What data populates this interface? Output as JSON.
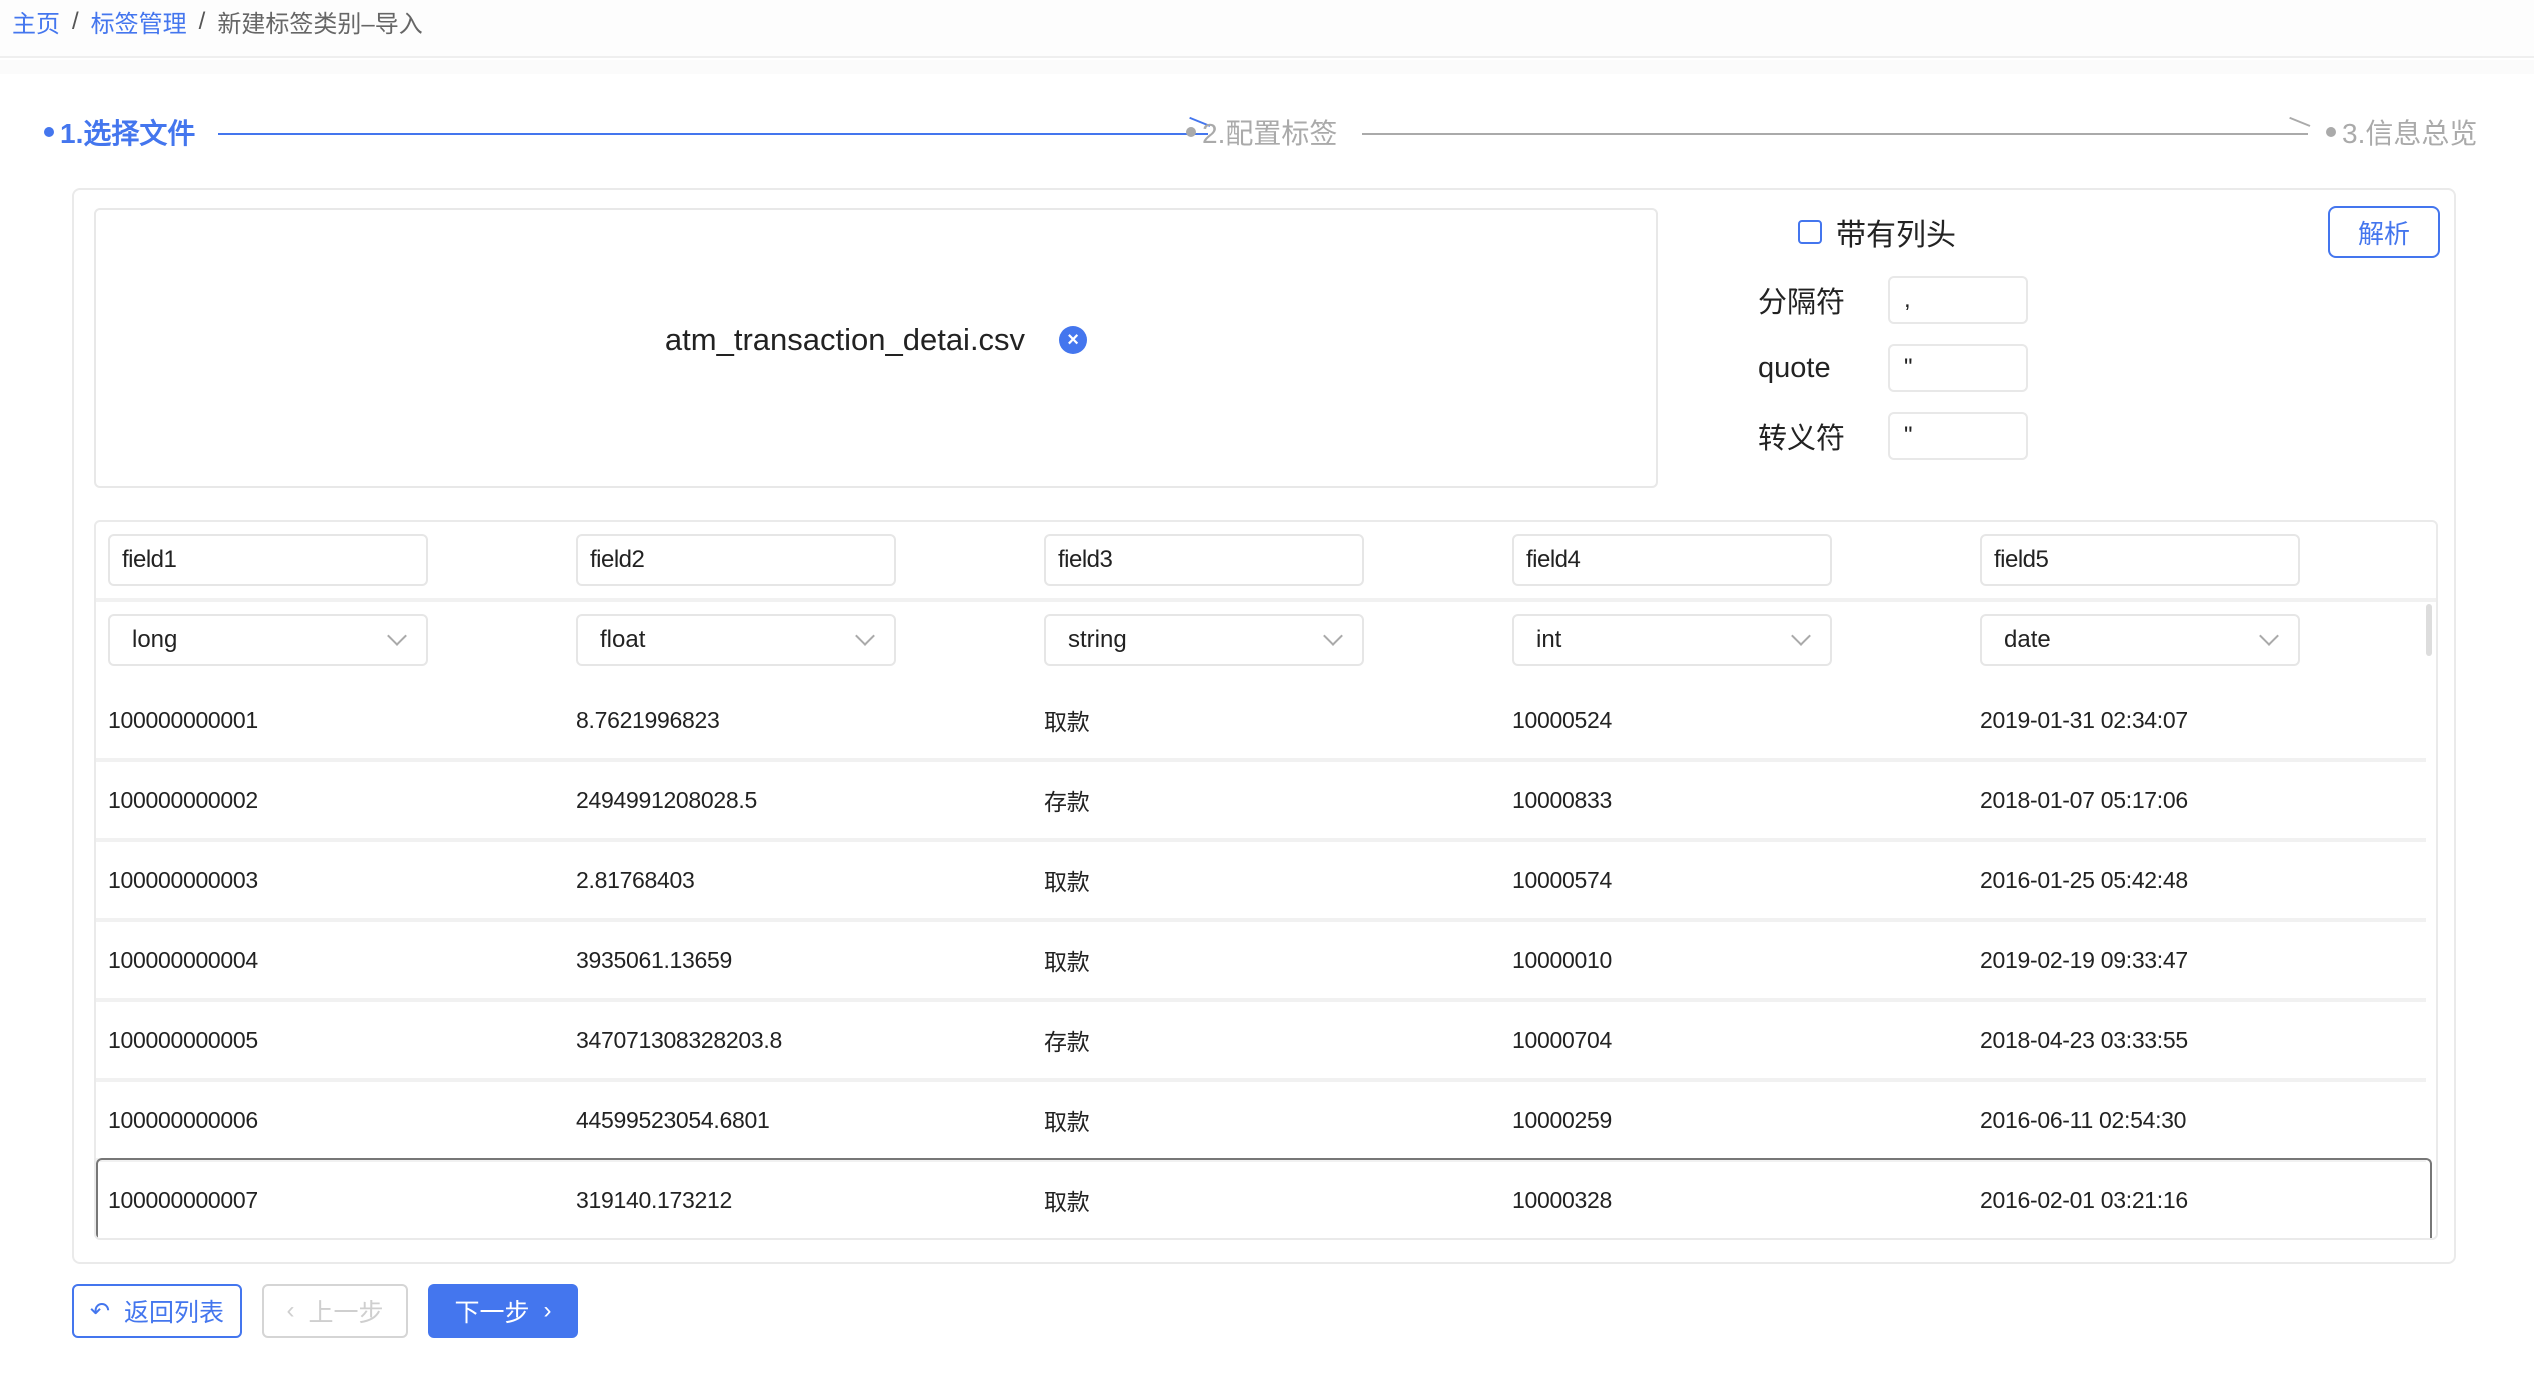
{
  "breadcrumb": {
    "items": [
      {
        "label": "主页",
        "link": true
      },
      {
        "label": "标签管理",
        "link": true
      },
      {
        "label": "新建标签类别–导入",
        "link": false
      }
    ],
    "separator": "/"
  },
  "steps": [
    {
      "label": "1.选择文件",
      "state": "active"
    },
    {
      "label": "2.配置标签",
      "state": "inactive"
    },
    {
      "label": "3.信息总览",
      "state": "inactive"
    }
  ],
  "colors": {
    "accent": "#4476ee",
    "inactive": "#aaaaaa",
    "disabled": "#cfcfcf"
  },
  "file": {
    "name": "atm_transaction_detai.csv",
    "clear_icon": "close-circle-icon"
  },
  "config": {
    "has_header_label": "带有列头",
    "has_header_checked": false,
    "parse_button": "解析",
    "delimiter_label": "分隔符",
    "delimiter_value": ",",
    "quote_label": "quote",
    "quote_value": "\"",
    "escape_label": "转义符",
    "escape_value": "\""
  },
  "table": {
    "columns": [
      {
        "name": "field1",
        "type": "long"
      },
      {
        "name": "field2",
        "type": "float"
      },
      {
        "name": "field3",
        "type": "string"
      },
      {
        "name": "field4",
        "type": "int"
      },
      {
        "name": "field5",
        "type": "date"
      }
    ],
    "rows": [
      [
        "100000000001",
        "8.7621996823",
        "取款",
        "10000524",
        "2019-01-31 02:34:07"
      ],
      [
        "100000000002",
        "2494991208028.5",
        "存款",
        "10000833",
        "2018-01-07 05:17:06"
      ],
      [
        "100000000003",
        "2.81768403",
        "取款",
        "10000574",
        "2016-01-25 05:42:48"
      ],
      [
        "100000000004",
        "3935061.13659",
        "取款",
        "10000010",
        "2019-02-19 09:33:47"
      ],
      [
        "100000000005",
        "347071308328203.8",
        "存款",
        "10000704",
        "2018-04-23 03:33:55"
      ],
      [
        "100000000006",
        "44599523054.6801",
        "取款",
        "10000259",
        "2016-06-11 02:54:30"
      ],
      [
        "100000000007",
        "319140.173212",
        "取款",
        "10000328",
        "2016-02-01 03:21:16"
      ]
    ]
  },
  "footer": {
    "back_label": "返回列表",
    "back_icon": "undo-icon",
    "prev_label": "上一步",
    "prev_disabled": true,
    "next_label": "下一步"
  }
}
